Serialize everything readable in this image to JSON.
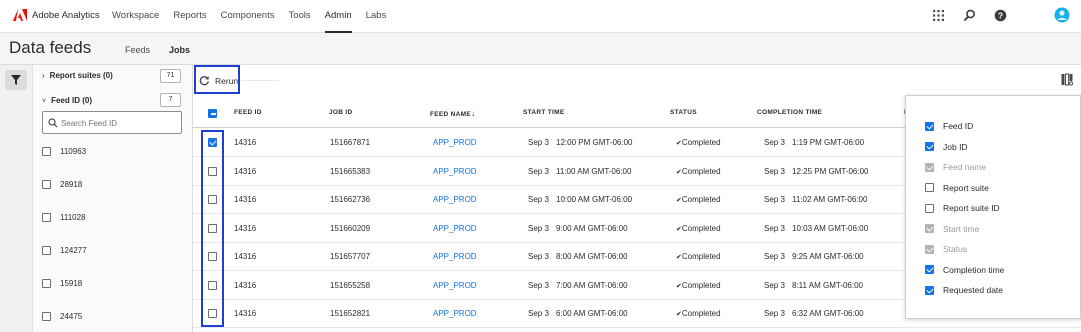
{
  "app": {
    "brand": "Adobe Analytics",
    "nav": [
      "Workspace",
      "Reports",
      "Components",
      "Tools",
      "Admin",
      "Labs"
    ],
    "active_nav": "Admin"
  },
  "page": {
    "title": "Data feeds",
    "tabs": [
      "Feeds",
      "Jobs"
    ],
    "active_tab": "Jobs"
  },
  "filters": {
    "report_suites_label": "Report suites (0)",
    "report_suites_count": "71",
    "feed_id_label": "Feed ID (0)",
    "feed_id_count": "7",
    "search_placeholder": "Search Feed ID",
    "feed_ids": [
      "110963",
      "28918",
      "111028",
      "124277",
      "15918",
      "24475"
    ]
  },
  "toolbar": {
    "rerun_label": "Rerun"
  },
  "table": {
    "columns": [
      "FEED ID",
      "JOB ID",
      "FEED NAME",
      "START TIME",
      "STATUS",
      "COMPLETION TIME",
      "F"
    ],
    "rows": [
      {
        "checked": true,
        "feed_id": "14316",
        "job_id": "151667871",
        "feed_name": "APP_PROD",
        "start_date": "Sep 3",
        "start_time": "12:00 PM GMT-06:00",
        "status": "Completed",
        "comp_date": "Sep 3",
        "comp_time": "1:19 PM GMT-06:00"
      },
      {
        "checked": false,
        "feed_id": "14316",
        "job_id": "151665383",
        "feed_name": "APP_PROD",
        "start_date": "Sep 3",
        "start_time": "11:00 AM GMT-06:00",
        "status": "Completed",
        "comp_date": "Sep 3",
        "comp_time": "12:25 PM GMT-06:00"
      },
      {
        "checked": false,
        "feed_id": "14316",
        "job_id": "151662736",
        "feed_name": "APP_PROD",
        "start_date": "Sep 3",
        "start_time": "10:00 AM GMT-06:00",
        "status": "Completed",
        "comp_date": "Sep 3",
        "comp_time": "11:02 AM GMT-06:00"
      },
      {
        "checked": false,
        "feed_id": "14316",
        "job_id": "151660209",
        "feed_name": "APP_PROD",
        "start_date": "Sep 3",
        "start_time": "9:00 AM GMT-06:00",
        "status": "Completed",
        "comp_date": "Sep 3",
        "comp_time": "10:03 AM GMT-06:00"
      },
      {
        "checked": false,
        "feed_id": "14316",
        "job_id": "151657707",
        "feed_name": "APP_PROD",
        "start_date": "Sep 3",
        "start_time": "8:00 AM GMT-06:00",
        "status": "Completed",
        "comp_date": "Sep 3",
        "comp_time": "9:25 AM GMT-06:00"
      },
      {
        "checked": false,
        "feed_id": "14316",
        "job_id": "151655258",
        "feed_name": "APP_PROD",
        "start_date": "Sep 3",
        "start_time": "7:00 AM GMT-06:00",
        "status": "Completed",
        "comp_date": "Sep 3",
        "comp_time": "8:11 AM GMT-06:00"
      },
      {
        "checked": false,
        "feed_id": "14316",
        "job_id": "151652821",
        "feed_name": "APP_PROD",
        "start_date": "Sep 3",
        "start_time": "6:00 AM GMT-06:00",
        "status": "Completed",
        "comp_date": "Sep 3",
        "comp_time": "6:32 AM GMT-06:00"
      }
    ]
  },
  "column_panel": {
    "items": [
      {
        "label": "Feed ID",
        "state": "checked"
      },
      {
        "label": "Job ID",
        "state": "checked"
      },
      {
        "label": "Feed name",
        "state": "disabled"
      },
      {
        "label": "Report suite",
        "state": "unchecked"
      },
      {
        "label": "Report suite ID",
        "state": "unchecked"
      },
      {
        "label": "Start time",
        "state": "disabled"
      },
      {
        "label": "Status",
        "state": "disabled"
      },
      {
        "label": "Completion time",
        "state": "checked"
      },
      {
        "label": "Requested date",
        "state": "checked"
      }
    ]
  },
  "colors": {
    "accent": "#1473e6",
    "highlight_border": "#1f3fce",
    "brand_red": "#eb1000"
  }
}
